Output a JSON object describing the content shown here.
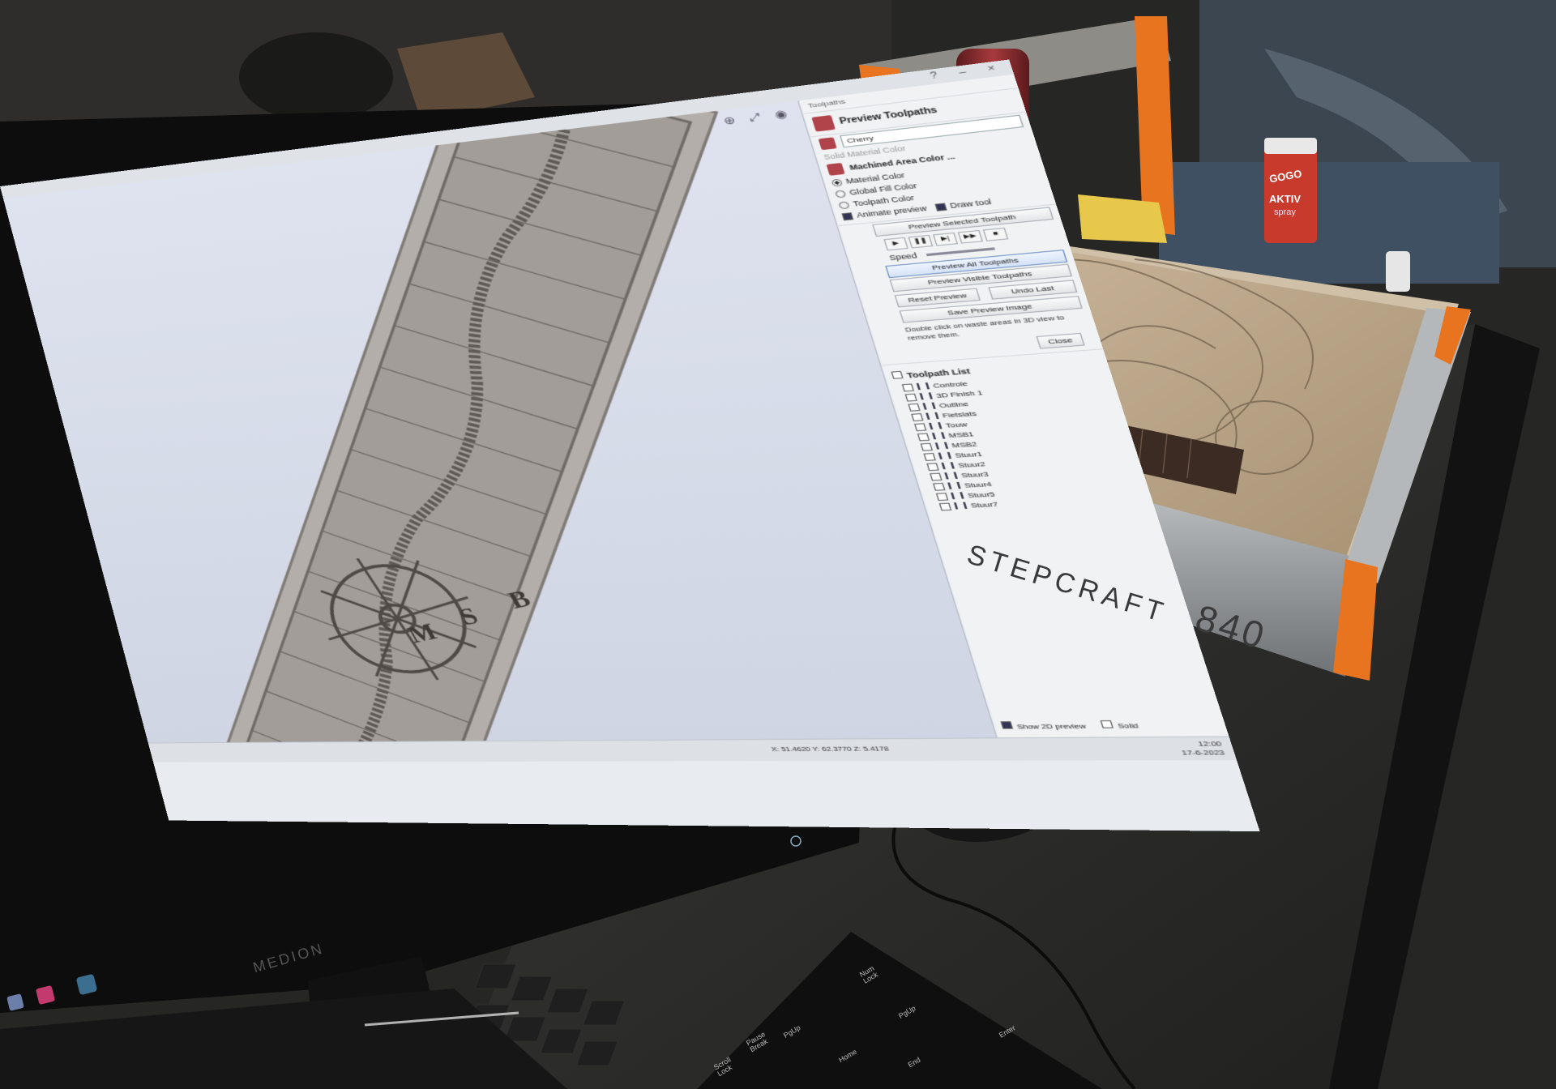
{
  "screen_app": {
    "panel_header": "Toolpaths",
    "preview_title": "Preview Toolpaths",
    "material": "Cherry",
    "solid_material_color": "Solid Material Color",
    "machined_area_color": "Machined Area Color ...",
    "opt_material_color": "Material Color",
    "opt_global_fill": "Global Fill Color",
    "opt_toolpath_color": "Toolpath Color",
    "animate_preview": "Animate preview",
    "draw_tool": "Draw tool",
    "preview_selected": "Preview Selected Toolpath",
    "speed": "Speed",
    "preview_all": "Preview All Toolpaths",
    "preview_visible": "Preview Visible Toolpaths",
    "reset_preview": "Reset Preview",
    "undo_last": "Undo Last",
    "save_preview": "Save Preview Image",
    "waste_note": "Double click on waste areas in 3D view to remove them.",
    "close": "Close",
    "toolpath_list_title": "Toolpath List",
    "toolpaths": [
      "Controle",
      "3D Finish 1",
      "Outline",
      "Fietslats",
      "Touw",
      "MSB1",
      "MSB2",
      "Stuur1",
      "Stuur2",
      "Stuur3",
      "Stuur4",
      "Stuur5",
      "Stuur7"
    ],
    "show_2d": "Show 2D preview",
    "solid": "Solid",
    "status_coords": "X: 51.4620 Y: 62.3770 Z: 5.4178",
    "clock_time": "12:00",
    "clock_date": "17-6-2023"
  },
  "carving_letters": [
    "M",
    "S",
    "B"
  ],
  "labels": {
    "machine_brand": "STEPCRAFT",
    "machine_model": "840",
    "monitor_brand": "MEDION",
    "spray_brand": "GOGO",
    "spray_text": "AKTIV",
    "spray_sub": "spray",
    "key_scroll": "Scroll Lock",
    "key_pause": "Pause Break",
    "key_numlock": "Num Lock",
    "key_pgup": "PgUp",
    "key_home": "Home",
    "key_end": "End",
    "key_enter": "Enter",
    "key_up": "PgUp"
  }
}
